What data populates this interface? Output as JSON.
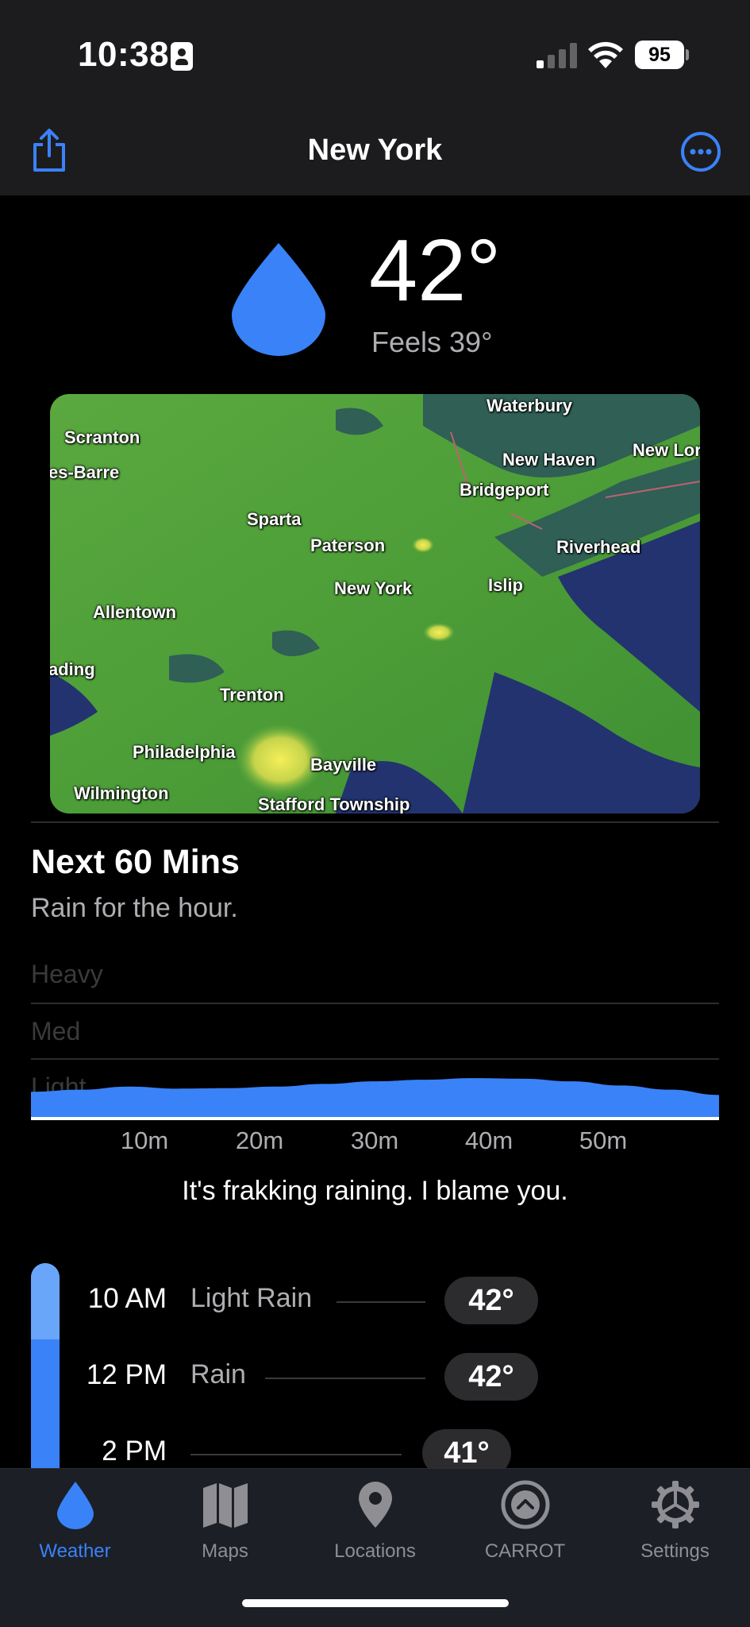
{
  "status_bar": {
    "time": "10:38",
    "battery": "95",
    "icons": [
      "id-card-icon",
      "cellular-signal-icon",
      "wifi-icon",
      "battery-icon"
    ]
  },
  "nav": {
    "title": "New York",
    "left_icon": "share-icon",
    "right_icon": "more-icon"
  },
  "current": {
    "icon": "raindrop-icon",
    "temperature": "42°",
    "feels_like": "Feels 39°"
  },
  "radar_map": {
    "labels": [
      "Waterbury",
      "Scranton",
      "New Haven",
      "New Lor",
      "es-Barre",
      "Bridgeport",
      "Sparta",
      "Paterson",
      "Riverhead",
      "New York",
      "Islip",
      "Allentown",
      "ading",
      "Trenton",
      "Philadelphia",
      "Bayville",
      "Wilmington",
      "Stafford Township"
    ]
  },
  "next_60": {
    "title": "Next 60 Mins",
    "summary": "Rain for the hour.",
    "levels": [
      "Heavy",
      "Med",
      "Light"
    ],
    "ticks": [
      "10m",
      "20m",
      "30m",
      "40m",
      "50m"
    ],
    "intensity": [
      0.48,
      0.52,
      0.58,
      0.54,
      0.55,
      0.58,
      0.63,
      0.68,
      0.71,
      0.74,
      0.73,
      0.68,
      0.6,
      0.52,
      0.42
    ],
    "quip": "It's frakking raining. I blame you."
  },
  "hourly": [
    {
      "time": "10 AM",
      "condition": "Light Rain",
      "temp": "42°"
    },
    {
      "time": "12 PM",
      "condition": "Rain",
      "temp": "42°"
    },
    {
      "time": "2 PM",
      "condition": "",
      "temp": "41°"
    }
  ],
  "tabs": [
    {
      "label": "Weather",
      "icon": "raindrop-icon",
      "active": true
    },
    {
      "label": "Maps",
      "icon": "map-icon",
      "active": false
    },
    {
      "label": "Locations",
      "icon": "location-pin-icon",
      "active": false
    },
    {
      "label": "CARROT",
      "icon": "carrot-logo-icon",
      "active": false
    },
    {
      "label": "Settings",
      "icon": "gear-icon",
      "active": false
    }
  ],
  "colors": {
    "accent": "#3a82f7",
    "background": "#000000",
    "bar_background": "#1c1c1e",
    "radar_green": "#4fa83a",
    "radar_water": "#23336f"
  }
}
